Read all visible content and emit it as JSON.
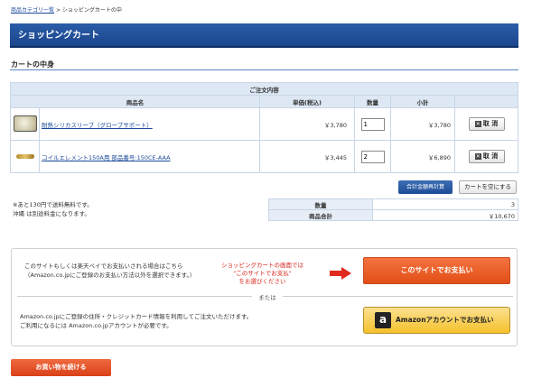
{
  "breadcrumb": {
    "link": "商品カテゴリ一覧",
    "separator": ">",
    "current": "ショッピングカートの中"
  },
  "header": {
    "title": "ショッピングカート"
  },
  "section": {
    "title": "カートの中身"
  },
  "table": {
    "caption": "ご注文内容",
    "headers": {
      "name": "商品名",
      "price": "単価(税込)",
      "qty": "数量",
      "subtotal": "小計"
    },
    "rows": [
      {
        "name": "耐熱シリカスリーブ（グローブサポート）",
        "price": "￥3,780",
        "qty": "1",
        "subtotal": "￥3,780",
        "delete": "取 消"
      },
      {
        "name": "コイルエレメント150A用 部品番号:150CE-AAA",
        "price": "￥3,445",
        "qty": "2",
        "subtotal": "￥6,890",
        "delete": "取 消"
      }
    ]
  },
  "buttons": {
    "recalc": "合計金額再計算",
    "empty_cart": "カートを空にする",
    "site_pay": "このサイトでお支払い",
    "amazon_pay": "Amazonアカウントでお支払い",
    "continue": "お買い物を続ける"
  },
  "notes": {
    "line1": "※あと130円で送料無料です。",
    "line2": "沖縄 は別途料金になります。"
  },
  "totals": {
    "qty_label": "数量",
    "qty_value": "3",
    "sum_label": "商品合計",
    "sum_value": "￥10,670"
  },
  "payment": {
    "text1_line1": "このサイトもしくは楽天ペイでお支払いされる場合はこちら",
    "text1_line2": "（Amazon.co.jpにご登録のお支払い方法以外を選択できます。）",
    "red_line1": "ショッピングカートの画面では",
    "red_line2": "\"このサイトでお支払\"",
    "red_line3": "をお選びください",
    "or": "または",
    "text2_line1": "Amazon.co.jpにご登録の住所・クレジットカード情報を利用してご注文いただけます。",
    "text2_line2": "ご利用になるには Amazon.co.jpアカウントが必要です。",
    "amazon_logo": "a"
  },
  "icons": {
    "delete": "x-box-icon",
    "arrow": "arrow-right-icon",
    "amazon": "amazon-logo-icon"
  },
  "colors": {
    "header": "#1b468c",
    "accent_red": "#d9261c",
    "site_button": "#e24e17",
    "amazon_button": "#f5c12c"
  }
}
